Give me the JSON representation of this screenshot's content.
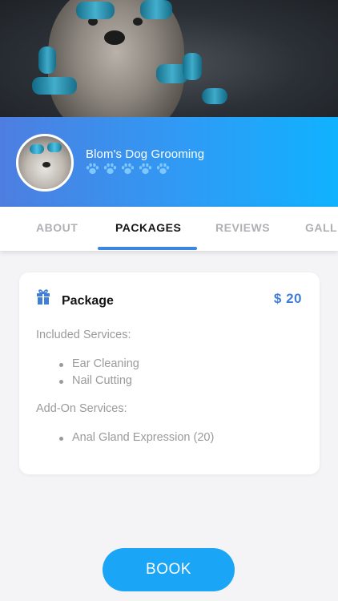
{
  "business": {
    "name": "Blom's Dog Grooming",
    "rating_paws": 5,
    "paw_icon": "paw-icon"
  },
  "tabs": [
    {
      "label": "ABOUT",
      "active": false
    },
    {
      "label": "PACKAGES",
      "active": true
    },
    {
      "label": "REVIEWS",
      "active": false
    },
    {
      "label": "GALLERY",
      "active": false
    }
  ],
  "package": {
    "icon": "gift-icon",
    "title": "Package",
    "price": "$ 20",
    "included_label": "Included Services:",
    "included_services": [
      "Ear Cleaning",
      "Nail Cutting"
    ],
    "addon_label": "Add-On Services:",
    "addon_services": [
      "Anal Gland Expression (20)"
    ]
  },
  "book_button": {
    "label": "BOOK"
  },
  "colors": {
    "band_start": "#4d7ee0",
    "band_end": "#10b2ff",
    "accent": "#3f7fd6",
    "button": "#1aa5f6",
    "paw": "#7fc8ff"
  }
}
